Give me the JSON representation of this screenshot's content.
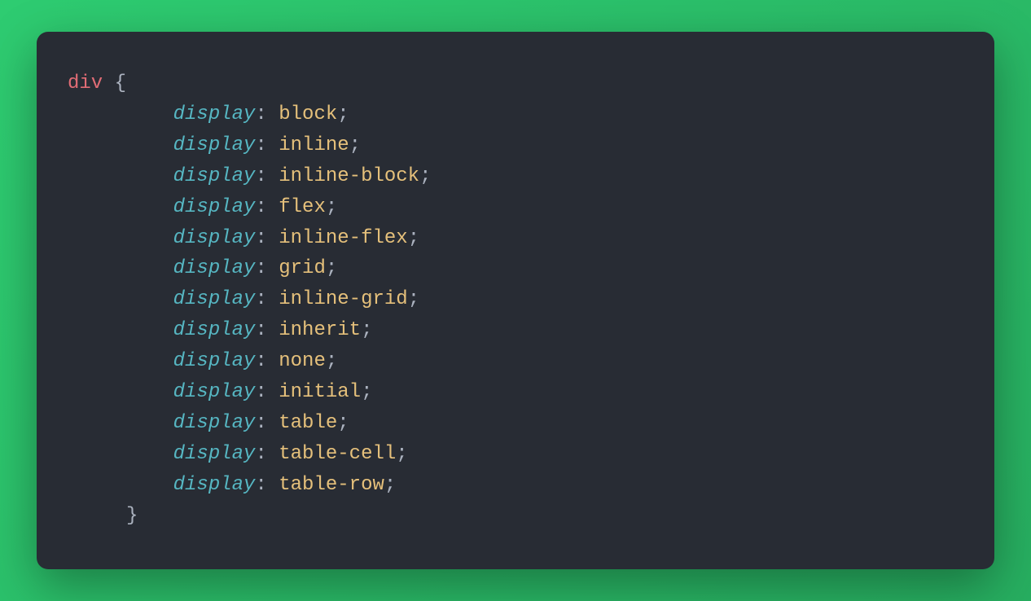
{
  "code": {
    "selector": "div",
    "open_brace": "{",
    "close_brace": "}",
    "property": "display",
    "colon": ":",
    "semicolon": ";",
    "declarations": [
      "block",
      "inline",
      "inline-block",
      "flex",
      "inline-flex",
      "grid",
      "inline-grid",
      "inherit",
      "none",
      "initial",
      "table",
      "table-cell",
      "table-row"
    ]
  },
  "colors": {
    "background_gradient_start": "#2ecc71",
    "background_gradient_end": "#27ae60",
    "panel_bg": "#282c34",
    "selector": "#e06c75",
    "punctuation": "#abb2bf",
    "property": "#56b6c2",
    "value": "#e5c07b"
  }
}
